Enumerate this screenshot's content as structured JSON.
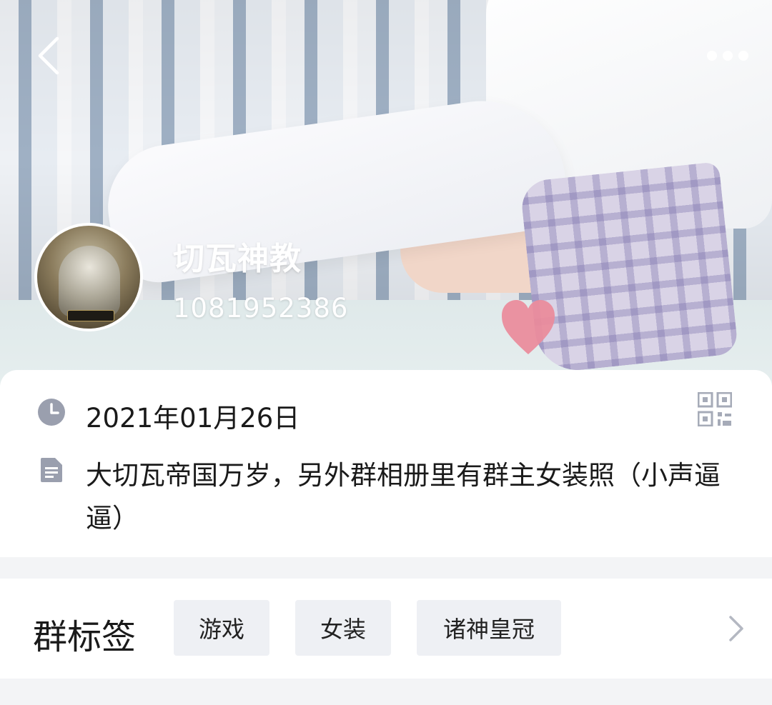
{
  "header": {
    "group_name": "切瓦神教",
    "group_id": "1081952386"
  },
  "icons": {
    "back": "chevron-left-icon",
    "more": "more-dots-icon",
    "date": "clock-icon",
    "intro": "document-icon",
    "qr": "qr-code-icon",
    "tags_more": "chevron-right-icon"
  },
  "info": {
    "date": "2021年01月26日",
    "intro": "大切瓦帝国万岁，另外群相册里有群主女装照（小声逼逼）"
  },
  "tags": {
    "title": "群标签",
    "items": [
      "游戏",
      "女装",
      "诸神皇冠"
    ]
  },
  "colors": {
    "icon_gray": "#9a9fae",
    "tag_bg": "#eef0f4",
    "page_bg": "#f3f4f6"
  }
}
